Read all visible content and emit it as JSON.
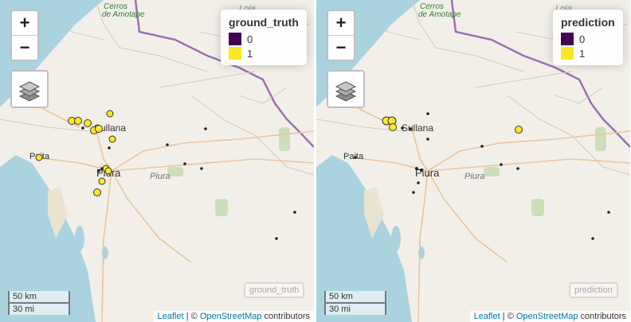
{
  "map": {
    "labels": {
      "cerros": "Cerros",
      "amotape": "de Amotape",
      "loja": "Loja",
      "sullana": "Sullana",
      "paita": "Paita",
      "piura": "Piura",
      "piura_region": "Piura"
    },
    "zoom_in": "+",
    "zoom_out": "−",
    "scale_km": "50 km",
    "scale_mi": "30 mi",
    "attribution": {
      "leaflet": "Leaflet",
      "separator": " | © ",
      "osm": "OpenStreetMap",
      "contributors": " contributors"
    }
  },
  "legend_colors": {
    "0": "#440154",
    "1": "#fde725"
  },
  "panels": [
    {
      "variable": "ground_truth",
      "legend_title": "ground_truth",
      "legend_items": [
        {
          "label": "0"
        },
        {
          "label": "1"
        }
      ],
      "ghost_label": "ground_truth"
    },
    {
      "variable": "prediction",
      "legend_title": "prediction",
      "legend_items": [
        {
          "label": "0"
        },
        {
          "label": "1"
        }
      ],
      "ghost_label": "prediction"
    }
  ]
}
